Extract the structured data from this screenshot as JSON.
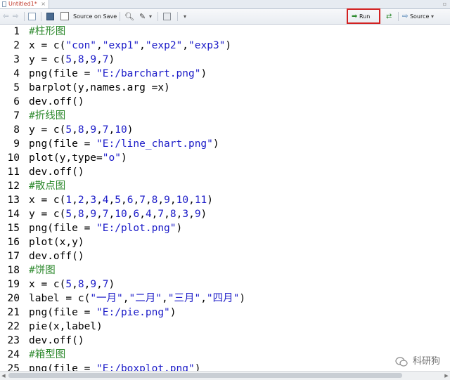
{
  "tab": {
    "title": "Untitled1*",
    "close": "×",
    "collapse": "▫"
  },
  "toolbar": {
    "source_on_save": "Source on Save",
    "run": "Run",
    "source": "Source",
    "back": "⇦",
    "forward": "⇨",
    "dropdown": "▾"
  },
  "editor": {
    "lines": [
      {
        "n": "1",
        "t": "#柱形图"
      },
      {
        "n": "2",
        "t": "x = c(\"con\",\"exp1\",\"exp2\",\"exp3\")"
      },
      {
        "n": "3",
        "t": "y = c(5,8,9,7)"
      },
      {
        "n": "4",
        "t": "png(file = \"E:/barchart.png\")"
      },
      {
        "n": "5",
        "t": "barplot(y,names.arg =x)"
      },
      {
        "n": "6",
        "t": "dev.off()"
      },
      {
        "n": "7",
        "t": "#折线图"
      },
      {
        "n": "8",
        "t": "y = c(5,8,9,7,10)"
      },
      {
        "n": "9",
        "t": "png(file = \"E:/line_chart.png\")"
      },
      {
        "n": "10",
        "t": "plot(y,type=\"o\")"
      },
      {
        "n": "11",
        "t": "dev.off()"
      },
      {
        "n": "12",
        "t": "#散点图"
      },
      {
        "n": "13",
        "t": "x = c(1,2,3,4,5,6,7,8,9,10,11)"
      },
      {
        "n": "14",
        "t": "y = c(5,8,9,7,10,6,4,7,8,3,9)"
      },
      {
        "n": "15",
        "t": "png(file = \"E:/plot.png\")"
      },
      {
        "n": "16",
        "t": "plot(x,y)"
      },
      {
        "n": "17",
        "t": "dev.off()"
      },
      {
        "n": "18",
        "t": "#饼图"
      },
      {
        "n": "19",
        "t": "x = c(5,8,9,7)"
      },
      {
        "n": "20",
        "t": "label = c(\"一月\",\"二月\",\"三月\",\"四月\")"
      },
      {
        "n": "21",
        "t": "png(file = \"E:/pie.png\")"
      },
      {
        "n": "22",
        "t": "pie(x,label)"
      },
      {
        "n": "23",
        "t": "dev.off()"
      },
      {
        "n": "24",
        "t": "#箱型图"
      },
      {
        "n": "25",
        "t": "png(file = \"E:/boxplot.png\")"
      }
    ]
  },
  "watermark": {
    "text": "科研狗"
  },
  "colors": {
    "comment": "#2f8a2f",
    "string": "#1c1cc8",
    "number": "#1c1cc8",
    "highlight_frame": "#d22121"
  }
}
